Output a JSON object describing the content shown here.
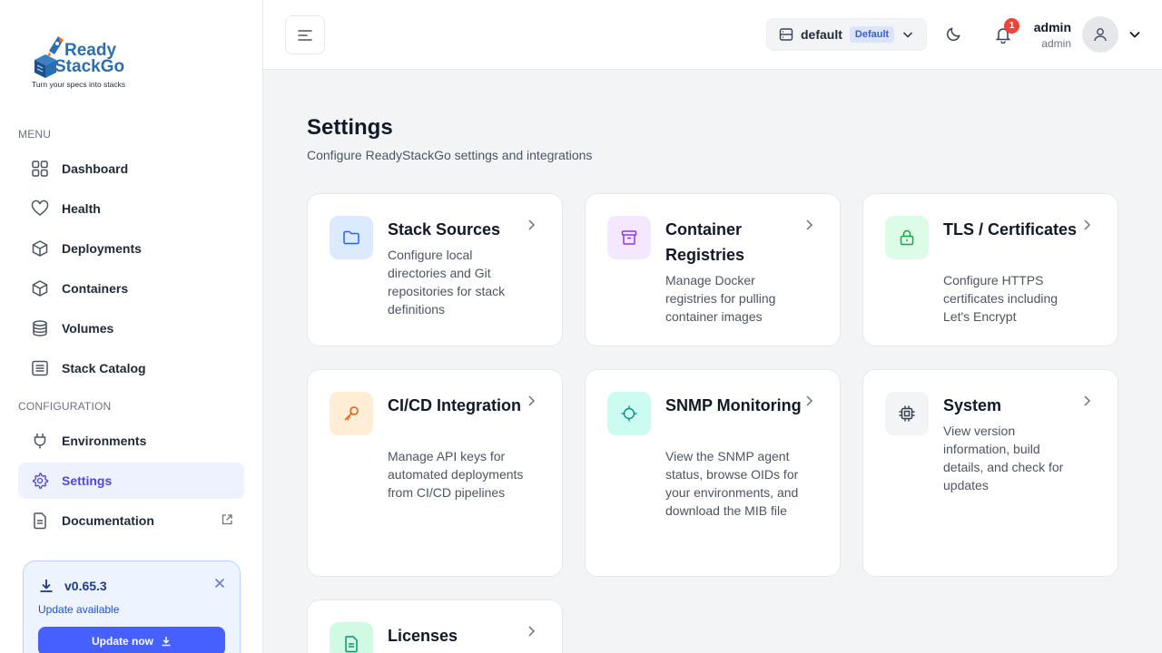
{
  "brand": {
    "word1": "Ready",
    "word2": "StackGo",
    "tagline": "Turn your specs into stacks"
  },
  "sidebar": {
    "menu_heading": "MENU",
    "config_heading": "CONFIGURATION",
    "items": [
      {
        "label": "Dashboard",
        "icon": "grid-icon"
      },
      {
        "label": "Health",
        "icon": "heart-icon"
      },
      {
        "label": "Deployments",
        "icon": "cube-icon"
      },
      {
        "label": "Containers",
        "icon": "cube-icon"
      },
      {
        "label": "Volumes",
        "icon": "database-icon"
      },
      {
        "label": "Stack Catalog",
        "icon": "list-icon"
      },
      {
        "label": "Environments",
        "icon": "plug-icon"
      },
      {
        "label": "Settings",
        "icon": "gear-icon",
        "active": true
      },
      {
        "label": "Documentation",
        "icon": "document-icon",
        "external": true
      }
    ]
  },
  "update": {
    "version": "v0.65.3",
    "text": "Update available",
    "button": "Update now"
  },
  "header": {
    "environment": "default",
    "environment_badge": "Default",
    "notifications": "1",
    "user_name": "admin",
    "user_role": "admin"
  },
  "page": {
    "title": "Settings",
    "subtitle": "Configure ReadyStackGo settings and integrations"
  },
  "cards": [
    {
      "title": "Stack Sources",
      "description": "Configure local directories and Git repositories for stack definitions",
      "icon": "folder-icon"
    },
    {
      "title": "Container Registries",
      "description": "Manage Docker registries for pulling container images",
      "icon": "archive-icon"
    },
    {
      "title": "TLS / Certificates",
      "description": "Configure HTTPS certificates including Let's Encrypt",
      "icon": "lock-icon"
    },
    {
      "title": "CI/CD Integration",
      "description": "Manage API keys for automated deployments from CI/CD pipelines",
      "icon": "key-icon"
    },
    {
      "title": "SNMP Monitoring",
      "description": "View the SNMP agent status, browse OIDs for your environments, and download the MIB file",
      "icon": "radar-icon"
    },
    {
      "title": "System",
      "description": "View version information, build details, and check for updates",
      "icon": "chip-icon"
    },
    {
      "title": "Licenses",
      "description": "",
      "icon": "file-text-icon"
    }
  ],
  "colors": {
    "accent": "#465fff",
    "active_bg": "#eef2ff",
    "active_text": "#4f46e5",
    "badge_red": "#f04438"
  }
}
